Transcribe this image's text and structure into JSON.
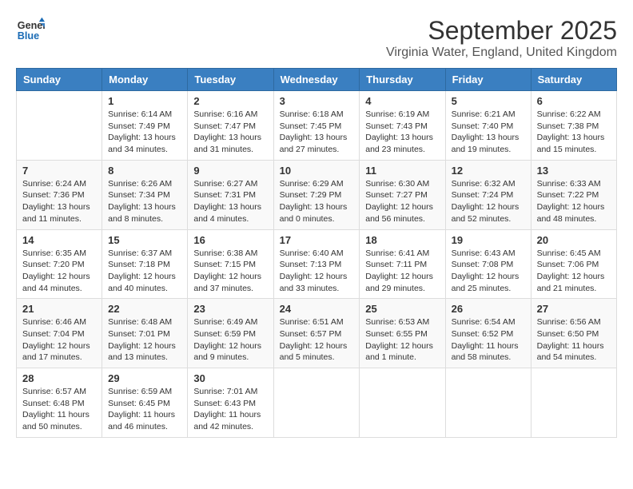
{
  "header": {
    "logo_line1": "General",
    "logo_line2": "Blue",
    "month": "September 2025",
    "location": "Virginia Water, England, United Kingdom"
  },
  "days_of_week": [
    "Sunday",
    "Monday",
    "Tuesday",
    "Wednesday",
    "Thursday",
    "Friday",
    "Saturday"
  ],
  "weeks": [
    [
      {
        "day": "",
        "info": ""
      },
      {
        "day": "1",
        "info": "Sunrise: 6:14 AM\nSunset: 7:49 PM\nDaylight: 13 hours\nand 34 minutes."
      },
      {
        "day": "2",
        "info": "Sunrise: 6:16 AM\nSunset: 7:47 PM\nDaylight: 13 hours\nand 31 minutes."
      },
      {
        "day": "3",
        "info": "Sunrise: 6:18 AM\nSunset: 7:45 PM\nDaylight: 13 hours\nand 27 minutes."
      },
      {
        "day": "4",
        "info": "Sunrise: 6:19 AM\nSunset: 7:43 PM\nDaylight: 13 hours\nand 23 minutes."
      },
      {
        "day": "5",
        "info": "Sunrise: 6:21 AM\nSunset: 7:40 PM\nDaylight: 13 hours\nand 19 minutes."
      },
      {
        "day": "6",
        "info": "Sunrise: 6:22 AM\nSunset: 7:38 PM\nDaylight: 13 hours\nand 15 minutes."
      }
    ],
    [
      {
        "day": "7",
        "info": "Sunrise: 6:24 AM\nSunset: 7:36 PM\nDaylight: 13 hours\nand 11 minutes."
      },
      {
        "day": "8",
        "info": "Sunrise: 6:26 AM\nSunset: 7:34 PM\nDaylight: 13 hours\nand 8 minutes."
      },
      {
        "day": "9",
        "info": "Sunrise: 6:27 AM\nSunset: 7:31 PM\nDaylight: 13 hours\nand 4 minutes."
      },
      {
        "day": "10",
        "info": "Sunrise: 6:29 AM\nSunset: 7:29 PM\nDaylight: 13 hours\nand 0 minutes."
      },
      {
        "day": "11",
        "info": "Sunrise: 6:30 AM\nSunset: 7:27 PM\nDaylight: 12 hours\nand 56 minutes."
      },
      {
        "day": "12",
        "info": "Sunrise: 6:32 AM\nSunset: 7:24 PM\nDaylight: 12 hours\nand 52 minutes."
      },
      {
        "day": "13",
        "info": "Sunrise: 6:33 AM\nSunset: 7:22 PM\nDaylight: 12 hours\nand 48 minutes."
      }
    ],
    [
      {
        "day": "14",
        "info": "Sunrise: 6:35 AM\nSunset: 7:20 PM\nDaylight: 12 hours\nand 44 minutes."
      },
      {
        "day": "15",
        "info": "Sunrise: 6:37 AM\nSunset: 7:18 PM\nDaylight: 12 hours\nand 40 minutes."
      },
      {
        "day": "16",
        "info": "Sunrise: 6:38 AM\nSunset: 7:15 PM\nDaylight: 12 hours\nand 37 minutes."
      },
      {
        "day": "17",
        "info": "Sunrise: 6:40 AM\nSunset: 7:13 PM\nDaylight: 12 hours\nand 33 minutes."
      },
      {
        "day": "18",
        "info": "Sunrise: 6:41 AM\nSunset: 7:11 PM\nDaylight: 12 hours\nand 29 minutes."
      },
      {
        "day": "19",
        "info": "Sunrise: 6:43 AM\nSunset: 7:08 PM\nDaylight: 12 hours\nand 25 minutes."
      },
      {
        "day": "20",
        "info": "Sunrise: 6:45 AM\nSunset: 7:06 PM\nDaylight: 12 hours\nand 21 minutes."
      }
    ],
    [
      {
        "day": "21",
        "info": "Sunrise: 6:46 AM\nSunset: 7:04 PM\nDaylight: 12 hours\nand 17 minutes."
      },
      {
        "day": "22",
        "info": "Sunrise: 6:48 AM\nSunset: 7:01 PM\nDaylight: 12 hours\nand 13 minutes."
      },
      {
        "day": "23",
        "info": "Sunrise: 6:49 AM\nSunset: 6:59 PM\nDaylight: 12 hours\nand 9 minutes."
      },
      {
        "day": "24",
        "info": "Sunrise: 6:51 AM\nSunset: 6:57 PM\nDaylight: 12 hours\nand 5 minutes."
      },
      {
        "day": "25",
        "info": "Sunrise: 6:53 AM\nSunset: 6:55 PM\nDaylight: 12 hours\nand 1 minute."
      },
      {
        "day": "26",
        "info": "Sunrise: 6:54 AM\nSunset: 6:52 PM\nDaylight: 11 hours\nand 58 minutes."
      },
      {
        "day": "27",
        "info": "Sunrise: 6:56 AM\nSunset: 6:50 PM\nDaylight: 11 hours\nand 54 minutes."
      }
    ],
    [
      {
        "day": "28",
        "info": "Sunrise: 6:57 AM\nSunset: 6:48 PM\nDaylight: 11 hours\nand 50 minutes."
      },
      {
        "day": "29",
        "info": "Sunrise: 6:59 AM\nSunset: 6:45 PM\nDaylight: 11 hours\nand 46 minutes."
      },
      {
        "day": "30",
        "info": "Sunrise: 7:01 AM\nSunset: 6:43 PM\nDaylight: 11 hours\nand 42 minutes."
      },
      {
        "day": "",
        "info": ""
      },
      {
        "day": "",
        "info": ""
      },
      {
        "day": "",
        "info": ""
      },
      {
        "day": "",
        "info": ""
      }
    ]
  ]
}
